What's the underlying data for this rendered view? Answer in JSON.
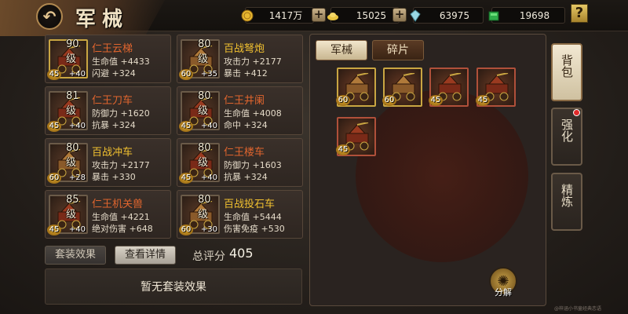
{
  "header": {
    "title": "军械",
    "back_icon": "back-arrow-icon"
  },
  "resources": [
    {
      "icon": "gold-coin-icon",
      "value": "1417万",
      "has_plus": true
    },
    {
      "icon": "silver-ingot-icon",
      "value": "15025",
      "has_plus": true
    },
    {
      "icon": "crystal-icon",
      "value": "63975",
      "has_plus": false
    },
    {
      "icon": "jade-icon",
      "value": "19698",
      "has_plus": false
    }
  ],
  "help_label": "?",
  "items": [
    {
      "level": "90级",
      "stars": "45",
      "plus": "+40",
      "name": "仁王云梯",
      "name_color": "red",
      "stat1": "生命值 +4433",
      "stat2": "闪避 +324"
    },
    {
      "level": "80级",
      "stars": "60",
      "plus": "+35",
      "name": "百战弩炮",
      "name_color": "gold",
      "stat1": "攻击力 +2177",
      "stat2": "暴击 +412"
    },
    {
      "level": "81级",
      "stars": "45",
      "plus": "+40",
      "name": "仁王刀车",
      "name_color": "red",
      "stat1": "防御力 +1620",
      "stat2": "抗暴 +324"
    },
    {
      "level": "80级",
      "stars": "45",
      "plus": "+40",
      "name": "仁王井阑",
      "name_color": "red",
      "stat1": "生命值 +4008",
      "stat2": "命中 +324"
    },
    {
      "level": "80级",
      "stars": "60",
      "plus": "+28",
      "name": "百战冲车",
      "name_color": "gold",
      "stat1": "攻击力 +2177",
      "stat2": "暴击 +330"
    },
    {
      "level": "80级",
      "stars": "45",
      "plus": "+40",
      "name": "仁王楼车",
      "name_color": "red",
      "stat1": "防御力 +1603",
      "stat2": "抗暴 +324"
    },
    {
      "level": "85级",
      "stars": "45",
      "plus": "+40",
      "name": "仁王机关兽",
      "name_color": "red",
      "stat1": "生命值 +4221",
      "stat2": "绝对伤害 +648"
    },
    {
      "level": "80级",
      "stars": "60",
      "plus": "+30",
      "name": "百战投石车",
      "name_color": "gold",
      "stat1": "生命值 +5444",
      "stat2": "伤害免疫 +530"
    }
  ],
  "buttons": {
    "set_effect": "套装效果",
    "view_detail": "查看详情"
  },
  "score": {
    "label": "总评分",
    "value": "405"
  },
  "set_effect_text": "暂无套装效果",
  "panel": {
    "tabs": [
      "军械",
      "碎片"
    ],
    "inventory": [
      {
        "stars": "60",
        "border": "gold"
      },
      {
        "stars": "60",
        "border": "gold"
      },
      {
        "stars": "45",
        "border": "red"
      },
      {
        "stars": "45",
        "border": "red"
      },
      {
        "stars": "45",
        "border": "red"
      }
    ],
    "decompose_label": "分解"
  },
  "side_tabs": [
    "背包",
    "强化",
    "精炼"
  ],
  "watermark": "@梓涵小书童经典恋语"
}
